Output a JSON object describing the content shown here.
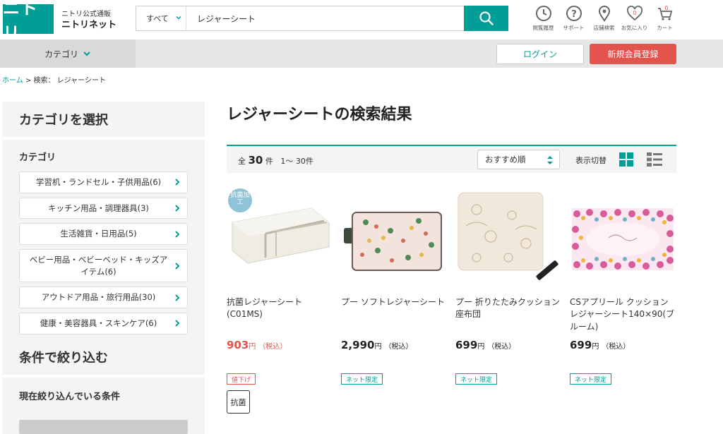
{
  "header": {
    "logo_text": "ニトリ",
    "brand_sub": "ニトリ公式通販",
    "brand_main": "ニトリネット",
    "search_category": "すべて",
    "search_value": "レジャーシート",
    "icons": [
      {
        "icon": "history-icon",
        "label": "閲覧履歴"
      },
      {
        "icon": "support-icon",
        "label": "サポート"
      },
      {
        "icon": "store-icon",
        "label": "店舗検索"
      },
      {
        "icon": "favorite-icon",
        "label": "お気に入り",
        "count": "0"
      },
      {
        "icon": "cart-icon",
        "label": "カート",
        "count": "0"
      }
    ]
  },
  "nav": {
    "category_label": "カテゴリ",
    "login_label": "ログイン",
    "register_label": "新規会員登録"
  },
  "breadcrumb": {
    "home": "ホーム",
    "separator": ">",
    "current": "検索： レジャーシート"
  },
  "sidebar": {
    "title": "カテゴリを選択",
    "subtitle": "カテゴリ",
    "items": [
      {
        "label": "学習机・ランドセル・子供用品(6)"
      },
      {
        "label": "キッチン用品・調理器具(3)"
      },
      {
        "label": "生活雑貨・日用品(5)"
      },
      {
        "label": "ベビー用品・ベビーベッド・キッズアイテム(6)"
      },
      {
        "label": "アウトドア用品・旅行用品(30)"
      },
      {
        "label": "健康・美容器具・スキンケア(6)"
      }
    ],
    "filter_title": "条件で絞り込む",
    "filter_subtitle": "現在絞り込んでいる条件"
  },
  "main": {
    "title": "レジャーシートの検索結果",
    "count_prefix": "全",
    "count_num": "30",
    "count_unit": "件",
    "range": "1～ 30件",
    "sort_value": "おすすめ順",
    "view_label": "表示切替"
  },
  "products": [
    {
      "name": "抗菌レジャーシート(C01MS)",
      "price": "903",
      "yen": "円",
      "tax": "（税込）",
      "badge": "値下げ",
      "tag": "抗菌",
      "ribbon": "抗菌加工"
    },
    {
      "name": "プー ソフトレジャーシート",
      "price": "2,990",
      "yen": "円",
      "tax": "（税込）",
      "badge": "ネット限定"
    },
    {
      "name": "プー 折りたたみクッション座布団",
      "price": "699",
      "yen": "円",
      "tax": "（税込）",
      "badge": "ネット限定"
    },
    {
      "name": "CSアプリール クッションレジャーシート140×90(ブルーム)",
      "price": "699",
      "yen": "円",
      "tax": "（税込）",
      "badge": "ネット限定"
    }
  ],
  "colors": {
    "brand": "#009e96",
    "sale": "#e3544c"
  }
}
